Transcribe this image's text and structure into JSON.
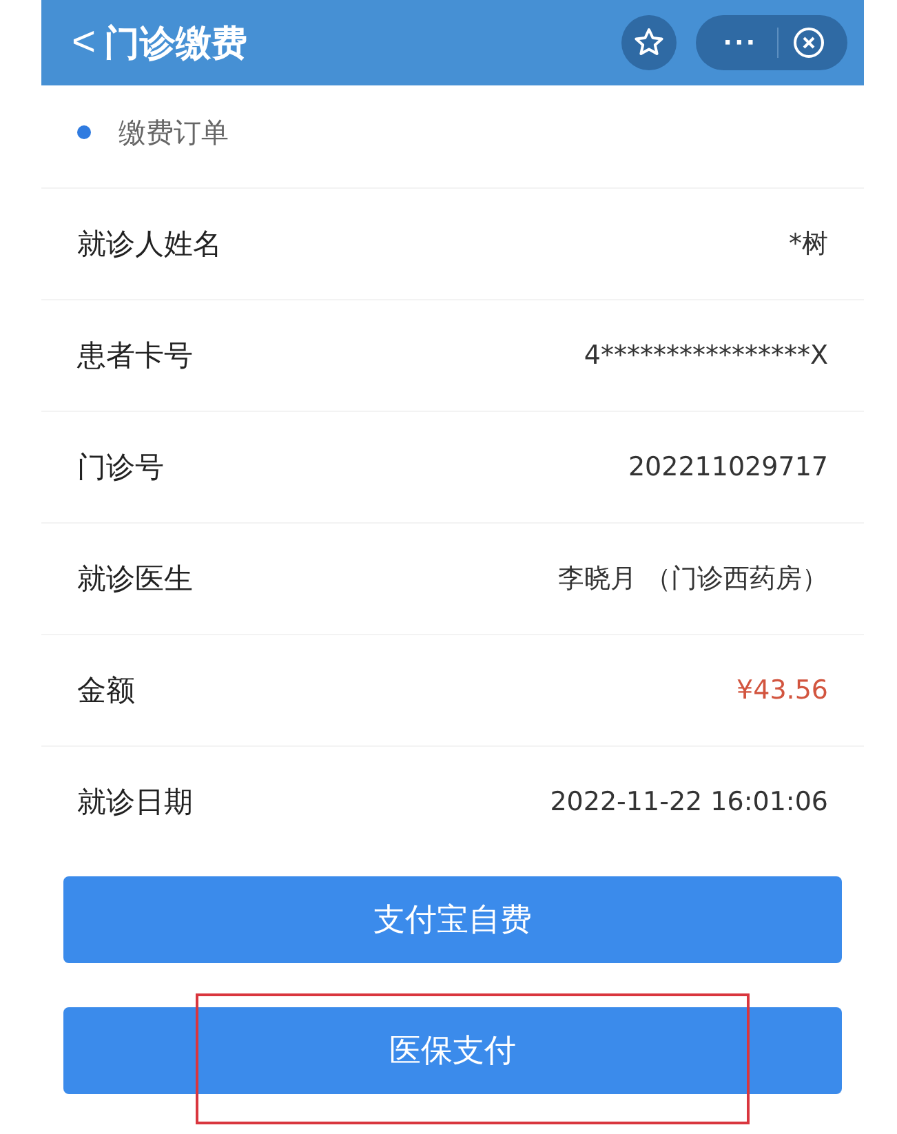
{
  "header": {
    "back": "<",
    "title": "门诊缴费",
    "more": "···"
  },
  "section": {
    "title": "缴费订单"
  },
  "rows": [
    {
      "label": "就诊人姓名",
      "value": "*树",
      "emphasis": false
    },
    {
      "label": "患者卡号",
      "value": "4****************X",
      "emphasis": false
    },
    {
      "label": "门诊号",
      "value": "202211029717",
      "emphasis": false
    },
    {
      "label": "就诊医生",
      "value": "李晓月 （门诊西药房）",
      "emphasis": false
    },
    {
      "label": "金额",
      "value": "¥43.56",
      "emphasis": true
    },
    {
      "label": "就诊日期",
      "value": "2022-11-22 16:01:06",
      "emphasis": false
    }
  ],
  "buttons": [
    {
      "label": "支付宝自费",
      "highlighted": false
    },
    {
      "label": "医保支付",
      "highlighted": true
    }
  ]
}
